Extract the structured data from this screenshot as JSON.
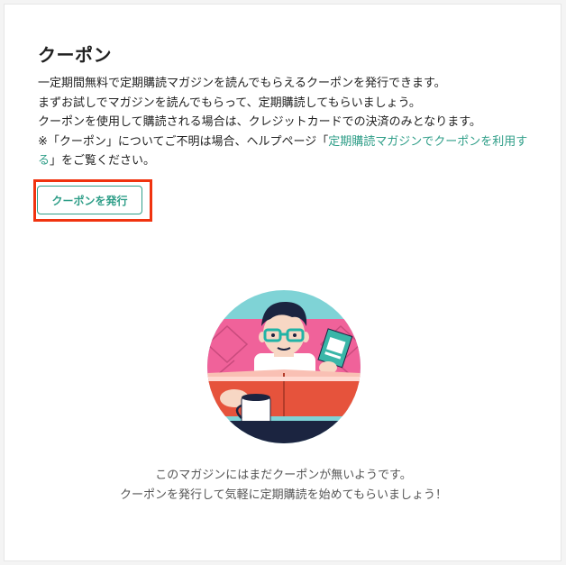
{
  "coupon": {
    "title": "クーポン",
    "desc_line1": "一定期間無料で定期購読マガジンを読んでもらえるクーポンを発行できます。",
    "desc_line2": "まずお試しでマガジンを読んでもらって、定期購読してもらいましょう。",
    "desc_line3": "クーポンを使用して購読される場合は、クレジットカードでの決済のみとなります。",
    "note_prefix": "※「クーポン」についてご不明は場合、ヘルプページ「",
    "note_link": "定期購読マガジンでクーポンを利用する",
    "note_suffix": "」をご覧ください。",
    "issue_button": "クーポンを発行"
  },
  "empty_state": {
    "line1": "このマガジンにはまだクーポンが無いようです。",
    "line2": "クーポンを発行して気軽に定期購読を始めてもらいましょう！"
  },
  "colors": {
    "accent": "#2f9e88",
    "highlight": "#f0330f"
  }
}
